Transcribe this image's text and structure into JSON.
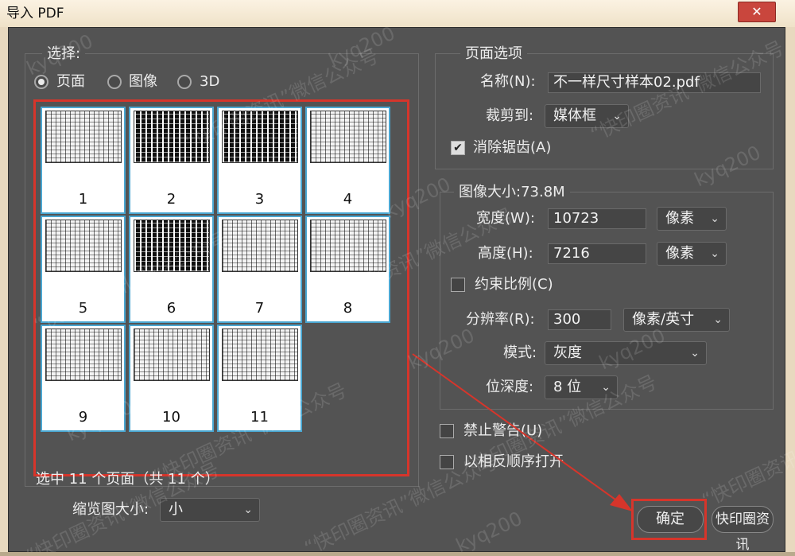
{
  "window": {
    "title": "导入 PDF",
    "close_label": "✕"
  },
  "select_group": {
    "title": "选择:",
    "radios": [
      {
        "label": "页面",
        "checked": true
      },
      {
        "label": "图像",
        "checked": false
      },
      {
        "label": "3D",
        "checked": false
      }
    ],
    "pages": [
      "1",
      "2",
      "3",
      "4",
      "5",
      "6",
      "7",
      "8",
      "9",
      "10",
      "11"
    ],
    "selection_status": "选中 11 个页面（共 11 个）",
    "thumb_size_label": "缩览图大小:",
    "thumb_size_value": "小"
  },
  "page_options": {
    "title": "页面选项",
    "name_label": "名称(N):",
    "name_value": "不一样尺寸样本02.pdf",
    "crop_label": "裁剪到:",
    "crop_value": "媒体框",
    "antialias_label": "消除锯齿(A)",
    "antialias_checked": true
  },
  "image_size": {
    "title": "图像大小:73.8M",
    "width_label": "宽度(W):",
    "width_value": "10723",
    "width_unit": "像素",
    "height_label": "高度(H):",
    "height_value": "7216",
    "height_unit": "像素",
    "constrain_label": "约束比例(C)",
    "constrain_checked": false,
    "resolution_label": "分辨率(R):",
    "resolution_value": "300",
    "resolution_unit": "像素/英寸",
    "mode_label": "模式:",
    "mode_value": "灰度",
    "depth_label": "位深度:",
    "depth_value": "8 位"
  },
  "options": {
    "suppress_warnings_label": "禁止警告(U)",
    "reverse_order_label": "以相反顺序打开"
  },
  "buttons": {
    "ok_label": "确定",
    "brand_label": "快印圈资讯"
  },
  "watermarks": [
    "kyq200",
    "“快印圈资讯”微信公众号"
  ],
  "colors": {
    "highlight": "#d6352b",
    "thumb_border": "#4aa7d2",
    "panel": "#535353"
  }
}
